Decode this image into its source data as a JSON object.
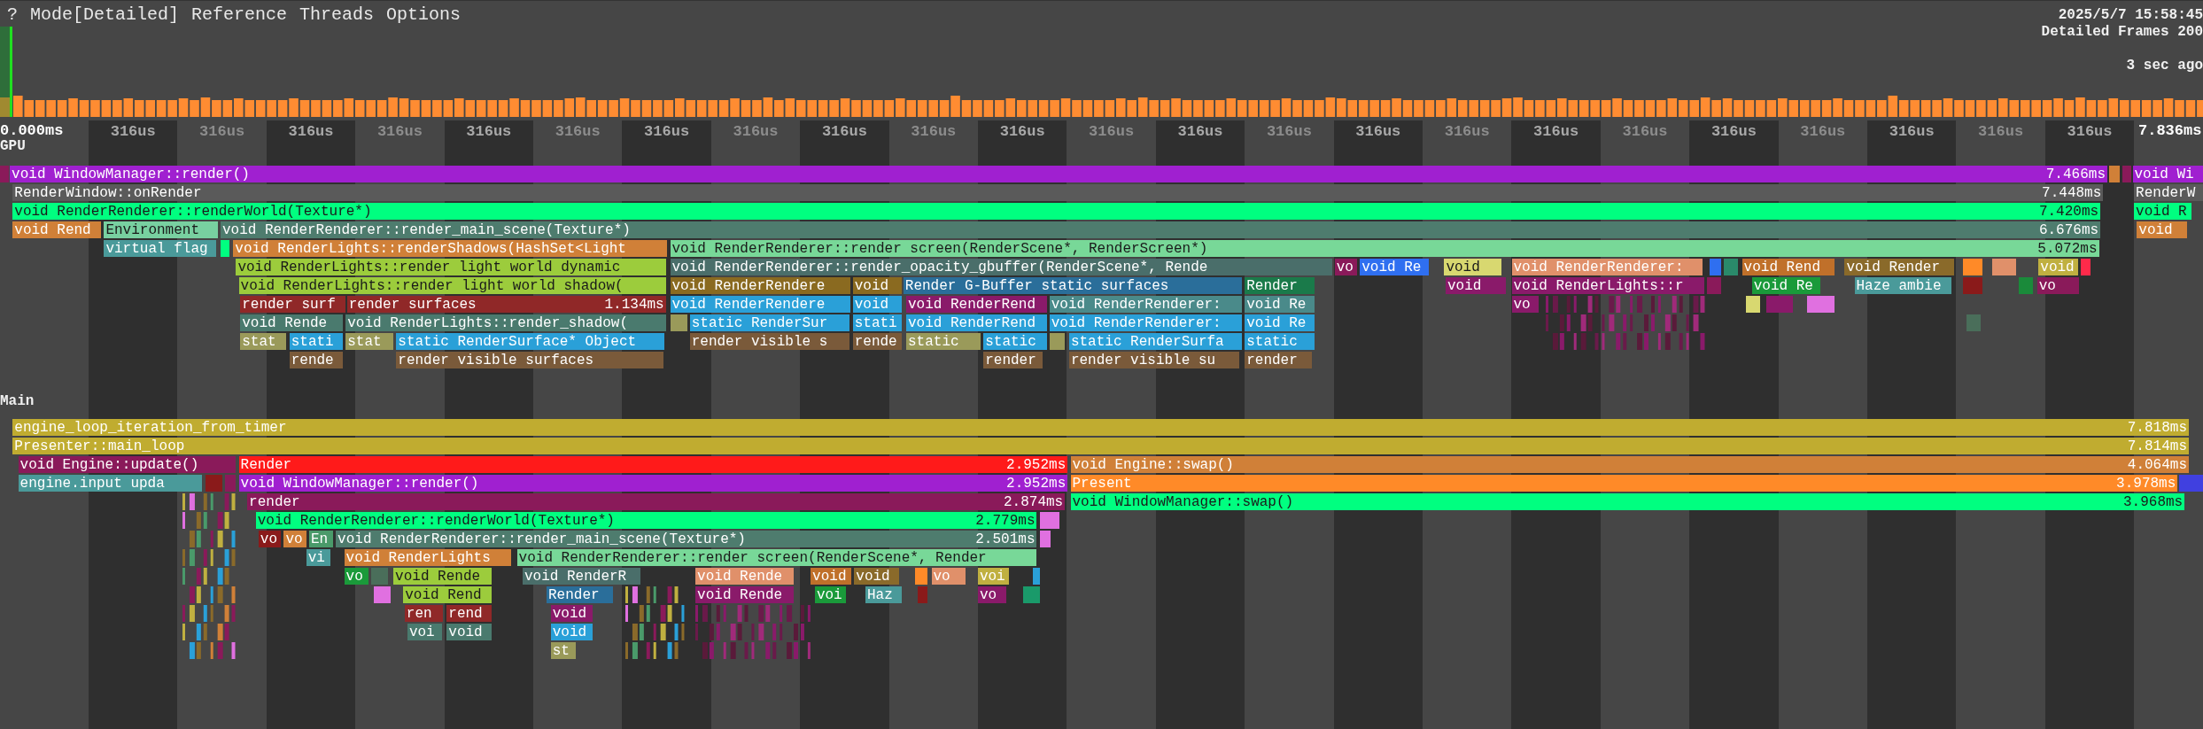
{
  "menu": [
    "?",
    "Mode[Detailed]",
    "Reference",
    "Threads",
    "Options"
  ],
  "header": {
    "date": "2025/5/7 15:58:45",
    "frames": "Detailed Frames 200",
    "age": "3 sec ago"
  },
  "timeline": {
    "start": "0.000ms",
    "end": "7.836ms",
    "ticks": [
      "316us",
      "316us",
      "316us",
      "316us",
      "316us",
      "316us",
      "316us",
      "316us",
      "316us",
      "316us",
      "316us",
      "316us",
      "316us",
      "316us",
      "316us",
      "316us",
      "316us",
      "316us",
      "316us",
      "316us",
      "316us",
      "316us",
      "316us"
    ]
  },
  "gpu": {
    "title": "GPU",
    "bars": [
      {
        "label": "void WindowManager::render()",
        "duration": "7.466ms",
        "color": "#a020d0"
      },
      {
        "label": "void Wi",
        "color": "#a020d0"
      },
      {
        "label": "RenderWindow::onRender",
        "duration": "7.448ms",
        "color": "#5a5a5a"
      },
      {
        "label": "RenderW",
        "color": "#5a5a5a"
      },
      {
        "label": "void RenderRenderer::renderWorld(Texture*)",
        "duration": "7.420ms",
        "color": "#00ff80"
      },
      {
        "label": "void R",
        "color": "#00ff80"
      },
      {
        "label": "void Rend",
        "color": "#d08038"
      },
      {
        "label": "Environment",
        "color": "#78d0a0"
      },
      {
        "label": "void RenderRenderer::render_main_scene(Texture*)",
        "duration": "6.676ms",
        "color": "#4e7c6e"
      },
      {
        "label": "void",
        "color": "#d08038"
      },
      {
        "label": "virtual flag",
        "color": "#4a9a9a"
      },
      {
        "label": "void RenderLights::renderShadows(HashSet<Light",
        "color": "#d08038"
      },
      {
        "label": "void RenderRenderer::render screen(RenderScene*, RenderScreen*)",
        "duration": "5.072ms",
        "color": "#78d898"
      },
      {
        "label": "void RenderLights::render light world dynamic",
        "color": "#9ccc3c"
      },
      {
        "label": "void RenderRenderer::render_opacity_gbuffer(RenderScene*, Rende",
        "color": "#4a6e6a"
      },
      {
        "label": "vo",
        "color": "#8a1a5a"
      },
      {
        "label": "void Re",
        "color": "#2f6ff0"
      },
      {
        "label": "void",
        "color": "#d8d870"
      },
      {
        "label": "void RenderRenderer:",
        "color": "#e0906a"
      },
      {
        "label": "void Rend",
        "color": "#c0702a"
      },
      {
        "label": "void Render",
        "color": "#8a6a2a"
      },
      {
        "label": "void",
        "color": "#c0b040"
      },
      {
        "label": "void RenderLights::render light world shadow(",
        "color": "#9ccc3c"
      },
      {
        "label": "void RenderRendere",
        "color": "#8a6a20"
      },
      {
        "label": "void",
        "color": "#8a6a20"
      },
      {
        "label": "Render G-Buffer static surfaces",
        "color": "#2a6e9a"
      },
      {
        "label": "Render",
        "color": "#1a7a4a"
      },
      {
        "label": "void",
        "color": "#8a1a6a"
      },
      {
        "label": "void RenderLights::r",
        "color": "#8a1a6a"
      },
      {
        "label": "void Re",
        "color": "#1a9a3a"
      },
      {
        "label": "Haze ambie",
        "color": "#4a9a9a"
      },
      {
        "label": "vo",
        "color": "#8a1a5a"
      },
      {
        "label": "render surf",
        "color": "#902828"
      },
      {
        "label": "render surfaces",
        "duration": "1.134ms",
        "color": "#902828"
      },
      {
        "label": "void RenderRendere",
        "color": "#2aa0d8"
      },
      {
        "label": "void",
        "color": "#2aa0d8"
      },
      {
        "label": "void RenderRend",
        "color": "#8a1a6a"
      },
      {
        "label": "void RenderRenderer:",
        "color": "#4a8a8a"
      },
      {
        "label": "void Re",
        "color": "#4a8a8a"
      },
      {
        "label": "vo",
        "color": "#8a1a6a"
      },
      {
        "label": "void Rende",
        "color": "#4a7a6e"
      },
      {
        "label": "void RenderLights::render_shadow(",
        "color": "#4a7a6e"
      },
      {
        "color": "#9a9a5a"
      },
      {
        "label": "static RenderSur",
        "color": "#2aa0d8"
      },
      {
        "label": "stati",
        "color": "#2aa0d8"
      },
      {
        "label": "void RenderRend",
        "color": "#2aa0d8"
      },
      {
        "label": "void RenderRenderer:",
        "color": "#2aa0d8"
      },
      {
        "label": "void Re",
        "color": "#2aa0d8"
      },
      {
        "label": "stat",
        "color": "#9a9a5a"
      },
      {
        "label": "stati",
        "color": "#2aa0d8"
      },
      {
        "label": "stat",
        "color": "#9a9a5a"
      },
      {
        "label": "static RenderSurface* Object",
        "color": "#2aa0d8"
      },
      {
        "label": "render visible s",
        "color": "#7a5a3a"
      },
      {
        "label": "rende",
        "color": "#7a5a3a"
      },
      {
        "label": "static",
        "color": "#9a9a5a"
      },
      {
        "label": "static",
        "color": "#2aa0d8"
      },
      {
        "color": "#9a9a5a"
      },
      {
        "label": "static RenderSurfa",
        "color": "#2aa0d8"
      },
      {
        "label": "static",
        "color": "#2aa0d8"
      },
      {
        "label": "rende",
        "color": "#7a5a3a"
      },
      {
        "label": "render visible surfaces",
        "color": "#7a5a3a"
      },
      {
        "label": "render",
        "color": "#7a5a3a"
      },
      {
        "label": "render visible su",
        "color": "#7a5a3a"
      },
      {
        "label": "render",
        "color": "#7a5a3a"
      },
      {
        "color": "#8a1a5a"
      },
      {
        "color": "#d08038"
      },
      {
        "color": "#8a1a5a"
      },
      {
        "color": "#00ff80"
      },
      {
        "color": "#2f6ff0"
      },
      {
        "color": "#2a8a6a"
      },
      {
        "color": "#ff8a28"
      },
      {
        "color": "#e0906a"
      },
      {
        "color": "#ff2a4a"
      },
      {
        "color": "#8a1a5a"
      },
      {
        "color": "#8a1a1a"
      },
      {
        "color": "#1a8a3a"
      },
      {
        "color": "#d8d870"
      },
      {
        "color": "#8a1a6a"
      },
      {
        "color": "#e070e0"
      },
      {
        "color": "#4a6e5a"
      }
    ]
  },
  "main": {
    "title": "Main",
    "bars": [
      {
        "label": "engine_loop_iteration_from_timer",
        "duration": "7.818ms",
        "color": "#c0ac30"
      },
      {
        "label": "Presenter::main_loop",
        "duration": "7.814ms",
        "color": "#c0ac30"
      },
      {
        "label": "void Engine::update()",
        "color": "#8a1a5a"
      },
      {
        "label": "Render",
        "duration": "2.952ms",
        "color": "#ff1a1a"
      },
      {
        "label": "void Engine::swap()",
        "duration": "4.064ms",
        "color": "#d08038"
      },
      {
        "label": "engine.input upda",
        "color": "#4a9a9a"
      },
      {
        "label": "void WindowManager::render()",
        "duration": "2.952ms",
        "color": "#a020d0"
      },
      {
        "label": "Present",
        "duration": "3.978ms",
        "color": "#ff8a28"
      },
      {
        "label": "render",
        "duration": "2.874ms",
        "color": "#8a1a5a"
      },
      {
        "label": "void WindowManager::swap()",
        "duration": "3.968ms",
        "color": "#00ff80"
      },
      {
        "label": "void RenderRenderer::renderWorld(Texture*)",
        "duration": "2.779ms",
        "color": "#00ff80"
      },
      {
        "label": "vo",
        "color": "#8a1a1a"
      },
      {
        "label": "vo",
        "color": "#d08038"
      },
      {
        "label": "En",
        "color": "#4a9a6a"
      },
      {
        "label": "void RenderRenderer::render_main_scene(Texture*)",
        "duration": "2.501ms",
        "color": "#4e7c6e"
      },
      {
        "label": "vi",
        "color": "#4a9a9a"
      },
      {
        "label": "void RenderLights",
        "color": "#d08038"
      },
      {
        "label": "void RenderRenderer::render screen(RenderScene*, Render",
        "color": "#78d898"
      },
      {
        "label": "vo",
        "color": "#1a9a3a"
      },
      {
        "label": "void Rende",
        "color": "#9ccc3c"
      },
      {
        "label": "void RenderR",
        "color": "#4a6e6a"
      },
      {
        "label": "void Rende",
        "color": "#e0906a"
      },
      {
        "label": "void",
        "color": "#c0702a"
      },
      {
        "label": "void",
        "color": "#8a6a2a"
      },
      {
        "label": "vo",
        "color": "#e0906a"
      },
      {
        "label": "voi",
        "color": "#c0b040"
      },
      {
        "label": "void Rend",
        "color": "#9ccc3c"
      },
      {
        "label": "Render",
        "color": "#2a6e9a"
      },
      {
        "label": "void Rende",
        "color": "#8a1a6a"
      },
      {
        "label": "voi",
        "color": "#1a9a3a"
      },
      {
        "label": "Haz",
        "color": "#4a9a9a"
      },
      {
        "label": "vo",
        "color": "#8a1a6a"
      },
      {
        "label": "ren",
        "color": "#902828"
      },
      {
        "label": "rend",
        "color": "#902828"
      },
      {
        "label": "void",
        "color": "#8a1a6a"
      },
      {
        "label": "voi",
        "color": "#4a7a6e"
      },
      {
        "label": "void",
        "color": "#4a7a6e"
      },
      {
        "label": "void",
        "color": "#2aa0d8"
      },
      {
        "label": "st",
        "color": "#9a9a5a"
      },
      {
        "color": "#4040e0"
      },
      {
        "color": "#8a1a1a"
      },
      {
        "color": "#8a1a5a"
      },
      {
        "color": "#e070e0"
      },
      {
        "color": "#e070e0"
      },
      {
        "color": "#ff8a28"
      },
      {
        "color": "#2aa0d8"
      },
      {
        "color": "#1a9a6a"
      },
      {
        "color": "#8a1a1a"
      },
      {
        "color": "#4a6e5a"
      },
      {
        "color": "#e070e0"
      }
    ]
  }
}
